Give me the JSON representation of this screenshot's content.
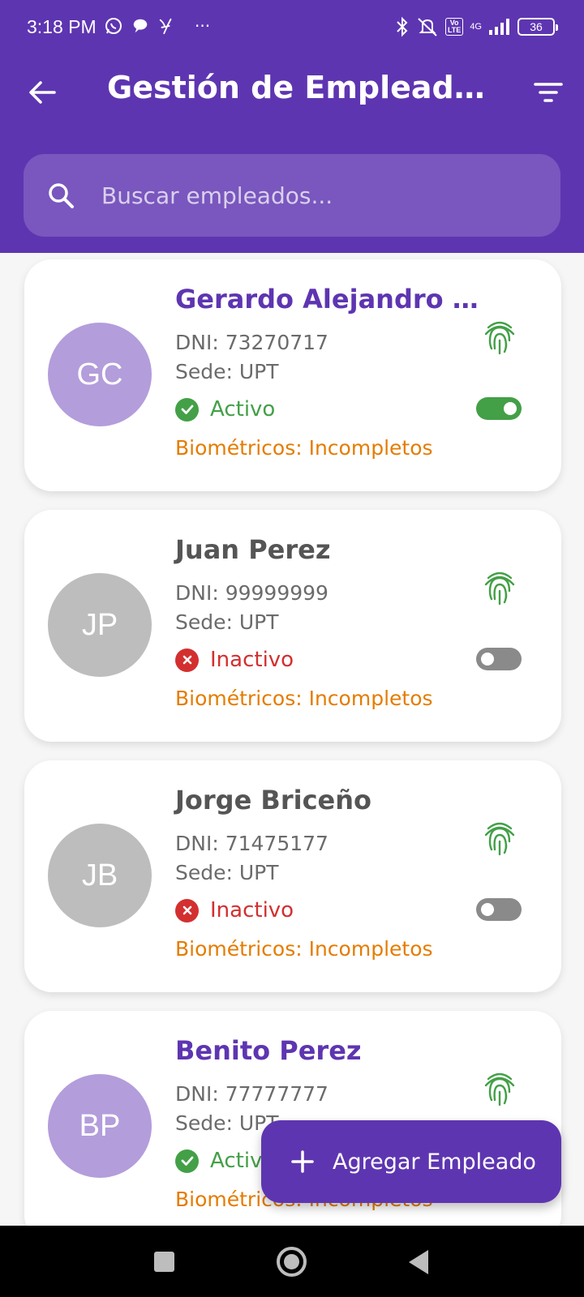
{
  "status_bar": {
    "time": "3:18 PM",
    "network": "4G",
    "volte": "Vo\nLTE",
    "battery": "36",
    "icons": [
      "whatsapp-icon",
      "chat-bubble-icon",
      "y-app-icon",
      "more-dots-icon",
      "bluetooth-icon",
      "mute-icon",
      "signal-icon",
      "battery-icon"
    ],
    "more": "···"
  },
  "app_bar": {
    "title": "Gestión de Emplead…",
    "back_icon": "arrow-left-icon",
    "filter_icon": "filter-icon"
  },
  "search": {
    "placeholder": "Buscar empleados..."
  },
  "colors": {
    "primary": "#5e35b1",
    "active": "#43a047",
    "inactive": "#d32f2f",
    "warning": "#e57c00",
    "avatar_active": "#b39ddb",
    "avatar_inactive": "#bdbdbd"
  },
  "employees": [
    {
      "initials": "GC",
      "name": "Gerardo Alejandro  …",
      "dni": "DNI: 73270717",
      "sede": "Sede: UPT",
      "status": "Activo",
      "active": true,
      "bio": "Biométricos: Incompletos"
    },
    {
      "initials": "JP",
      "name": "Juan Perez",
      "dni": "DNI: 99999999",
      "sede": "Sede: UPT",
      "status": "Inactivo",
      "active": false,
      "bio": "Biométricos: Incompletos"
    },
    {
      "initials": "JB",
      "name": "Jorge Briceño",
      "dni": "DNI: 71475177",
      "sede": "Sede: UPT",
      "status": "Inactivo",
      "active": false,
      "bio": "Biométricos: Incompletos"
    },
    {
      "initials": "BP",
      "name": "Benito Perez",
      "dni": "DNI: 77777777",
      "sede": "Sede: UPT",
      "status": "Activo",
      "active": true,
      "bio": "Biométricos: Incompletos"
    }
  ],
  "fab": {
    "label": "Agregar Empleado",
    "icon": "plus-icon"
  }
}
